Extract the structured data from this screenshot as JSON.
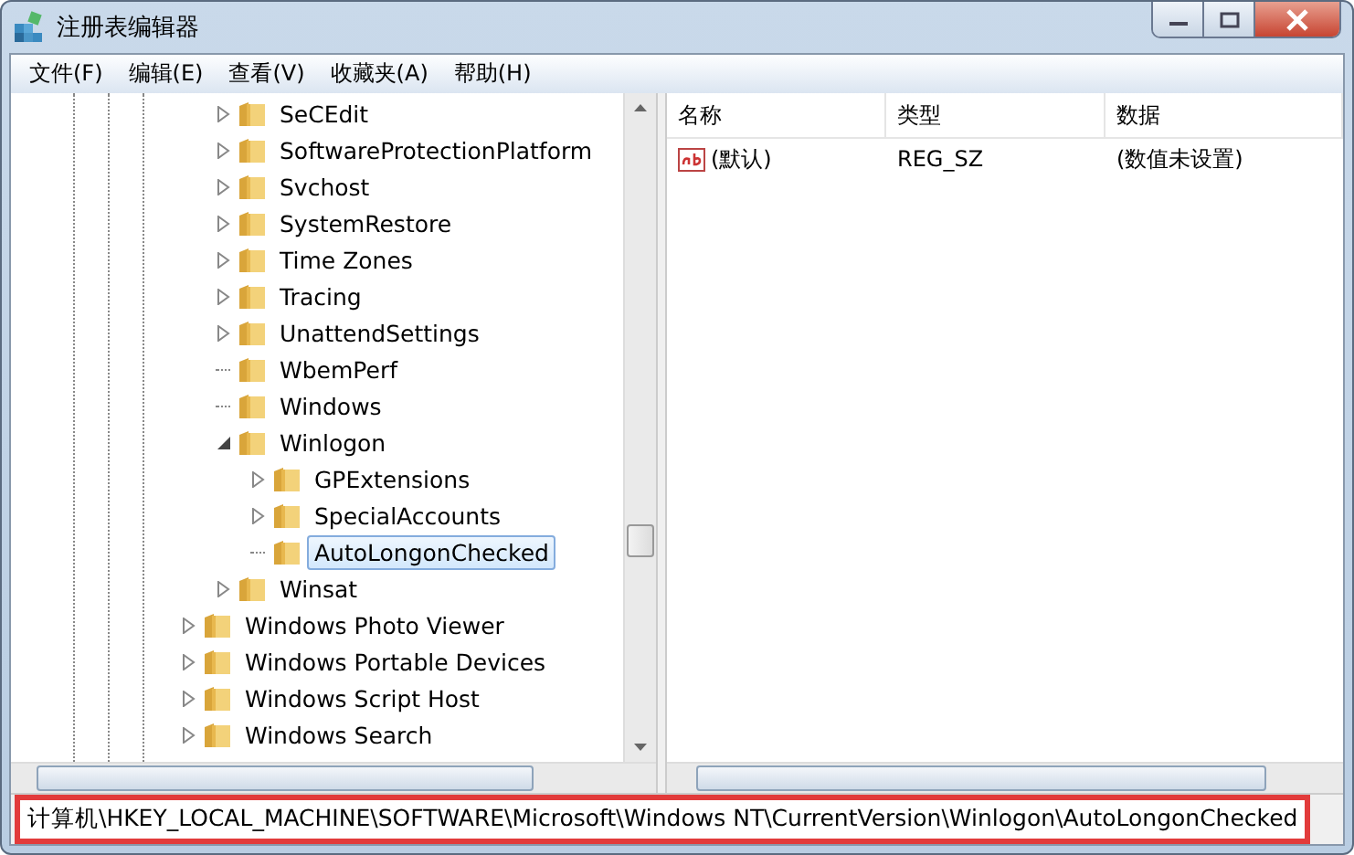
{
  "window": {
    "title": "注册表编辑器"
  },
  "menu": [
    "文件(F)",
    "编辑(E)",
    "查看(V)",
    "收藏夹(A)",
    "帮助(H)"
  ],
  "tree": {
    "continued_children": [
      {
        "label": "SeCEdit",
        "kind": "collapsed",
        "selected": false
      },
      {
        "label": "SoftwareProtectionPlatform",
        "kind": "collapsed",
        "selected": false
      },
      {
        "label": "Svchost",
        "kind": "collapsed",
        "selected": false
      },
      {
        "label": "SystemRestore",
        "kind": "collapsed",
        "selected": false
      },
      {
        "label": "Time Zones",
        "kind": "collapsed",
        "selected": false
      },
      {
        "label": "Tracing",
        "kind": "collapsed",
        "selected": false
      },
      {
        "label": "UnattendSettings",
        "kind": "collapsed",
        "selected": false
      },
      {
        "label": "WbemPerf",
        "kind": "leaf",
        "selected": false
      },
      {
        "label": "Windows",
        "kind": "leaf",
        "selected": false
      },
      {
        "label": "Winlogon",
        "kind": "expanded",
        "selected": false,
        "children": [
          {
            "label": "GPExtensions",
            "kind": "collapsed",
            "selected": false
          },
          {
            "label": "SpecialAccounts",
            "kind": "collapsed",
            "selected": false
          },
          {
            "label": "AutoLongonChecked",
            "kind": "leaf",
            "selected": true
          }
        ]
      },
      {
        "label": "Winsat",
        "kind": "collapsed",
        "selected": false
      }
    ],
    "items": [
      {
        "label": "Windows Photo Viewer",
        "kind": "collapsed",
        "selected": false
      },
      {
        "label": "Windows Portable Devices",
        "kind": "collapsed",
        "selected": false
      },
      {
        "label": "Windows Script Host",
        "kind": "collapsed",
        "selected": false
      },
      {
        "label": "Windows Search",
        "kind": "collapsed",
        "selected": false
      }
    ]
  },
  "values": {
    "columns": [
      "名称",
      "类型",
      "数据"
    ],
    "rows": [
      {
        "name": "(默认)",
        "type": "REG_SZ",
        "data": "(数值未设置)"
      }
    ]
  },
  "status_bar": "计算机\\HKEY_LOCAL_MACHINE\\SOFTWARE\\Microsoft\\Windows NT\\CurrentVersion\\Winlogon\\AutoLongonChecked"
}
